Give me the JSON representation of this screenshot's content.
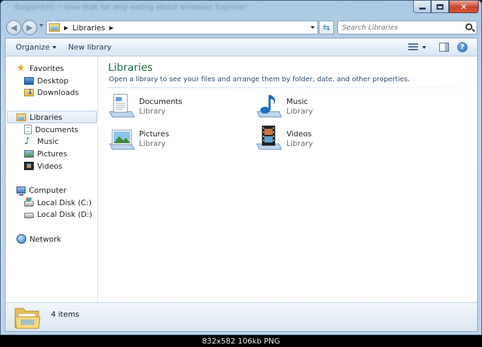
{
  "window": {
    "title": "Sixgun101: i love that fat dog eating about windows Explorer"
  },
  "navigation": {
    "address_segments": [
      "Libraries"
    ],
    "search_placeholder": "Search Libraries"
  },
  "toolbar": {
    "organize_label": "Organize",
    "new_library_label": "New library"
  },
  "sidebar": {
    "favorites": {
      "label": "Favorites",
      "items": [
        {
          "label": "Desktop",
          "icon": "desktop-icon"
        },
        {
          "label": "Downloads",
          "icon": "downloads-icon"
        }
      ]
    },
    "libraries": {
      "label": "Libraries",
      "selected": true,
      "items": [
        {
          "label": "Documents",
          "icon": "documents-icon"
        },
        {
          "label": "Music",
          "icon": "music-icon"
        },
        {
          "label": "Pictures",
          "icon": "pictures-icon"
        },
        {
          "label": "Videos",
          "icon": "videos-icon"
        }
      ]
    },
    "computer": {
      "label": "Computer",
      "items": [
        {
          "label": "Local Disk (C:)",
          "icon": "system-disk-icon"
        },
        {
          "label": "Local Disk (D:)",
          "icon": "disk-icon"
        }
      ]
    },
    "network": {
      "label": "Network"
    }
  },
  "main": {
    "title": "Libraries",
    "description": "Open a library to see your files and arrange them by folder, date, and other properties.",
    "libraries": [
      {
        "name": "Documents",
        "type": "Library",
        "icon": "documents-library-icon"
      },
      {
        "name": "Music",
        "type": "Library",
        "icon": "music-library-icon"
      },
      {
        "name": "Pictures",
        "type": "Library",
        "icon": "pictures-library-icon"
      },
      {
        "name": "Videos",
        "type": "Library",
        "icon": "videos-library-icon"
      }
    ]
  },
  "status": {
    "item_count": "4 items"
  },
  "image_caption": "832x582  106kb  PNG",
  "colors": {
    "title_green": "#1f6e3a",
    "selection_bg": "#dfe9f5",
    "close_button": "#c7432a"
  }
}
